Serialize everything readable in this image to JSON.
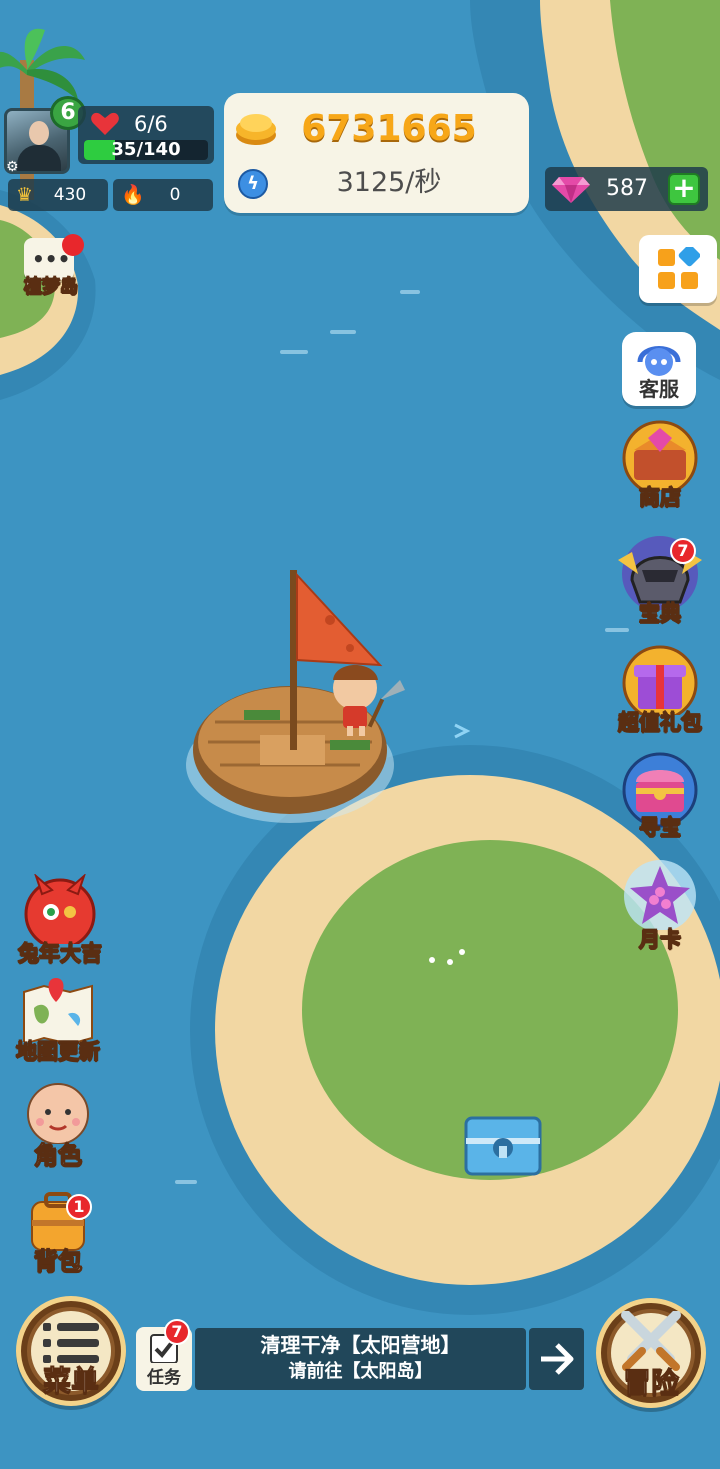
{
  "player": {
    "level": "6",
    "hp": "6/6",
    "stamina_text": "35/140",
    "stamina_fraction": 0.25,
    "crowns": "430",
    "fire": "0"
  },
  "currency": {
    "coins": "6731665",
    "rate": "3125/秒",
    "gems": "587"
  },
  "left_buttons": {
    "dream_island": "植梦岛",
    "rabbit_year": "兔年大吉",
    "map_update": "地图更新",
    "character": "角色",
    "backpack": "背包",
    "backpack_badge": "1"
  },
  "right_buttons": {
    "service": "客服",
    "shop": "商店",
    "codex": "宝典",
    "codex_badge": "7",
    "gift_pack": "超值礼包",
    "treasure_hunt": "寻宝",
    "monthly_card": "月卡"
  },
  "bottom": {
    "menu": "菜单",
    "task": "任务",
    "task_badge": "7",
    "task_title": "清理干净【太阳营地】",
    "task_sub": "请前往【太阳岛】",
    "adventure": "冒险"
  },
  "colors": {
    "sea": "#3d94c2",
    "sand": "#f2d7a3",
    "grass": "#7fb255",
    "coin_text": "#f7a718",
    "gem_plus": "#3ec63f"
  }
}
